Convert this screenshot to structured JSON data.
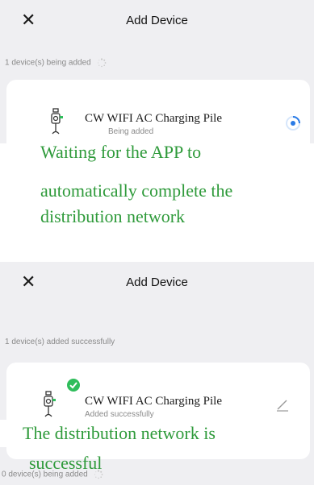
{
  "panel1": {
    "close_glyph": "✕",
    "title": "Add Device",
    "count_text": "1 device(s) being added",
    "device_name": "CW WIFI AC Charging Pile",
    "device_status": "Being added",
    "overlay_lines": [
      "Waiting for the APP to",
      "automatically complete the",
      "distribution network"
    ]
  },
  "panel2": {
    "close_glyph": "✕",
    "title": "Add Device",
    "count_text": "1 device(s) added successfully",
    "device_name": "CW WIFI AC Charging Pile",
    "device_status": "Added successfully",
    "overlay_lines": [
      "The distribution network is",
      "successful"
    ],
    "bottom_count_text": "0 device(s) being added"
  },
  "colors": {
    "accent_blue": "#2a7be6",
    "success_green": "#2fbd5b",
    "overlay_text": "#2e9a3a",
    "panel_bg": "#efeff2"
  },
  "icons": [
    "close-icon",
    "loading-spinner-icon",
    "charger-device-icon",
    "progress-spinner-icon",
    "success-check-icon",
    "edit-pencil-icon"
  ]
}
